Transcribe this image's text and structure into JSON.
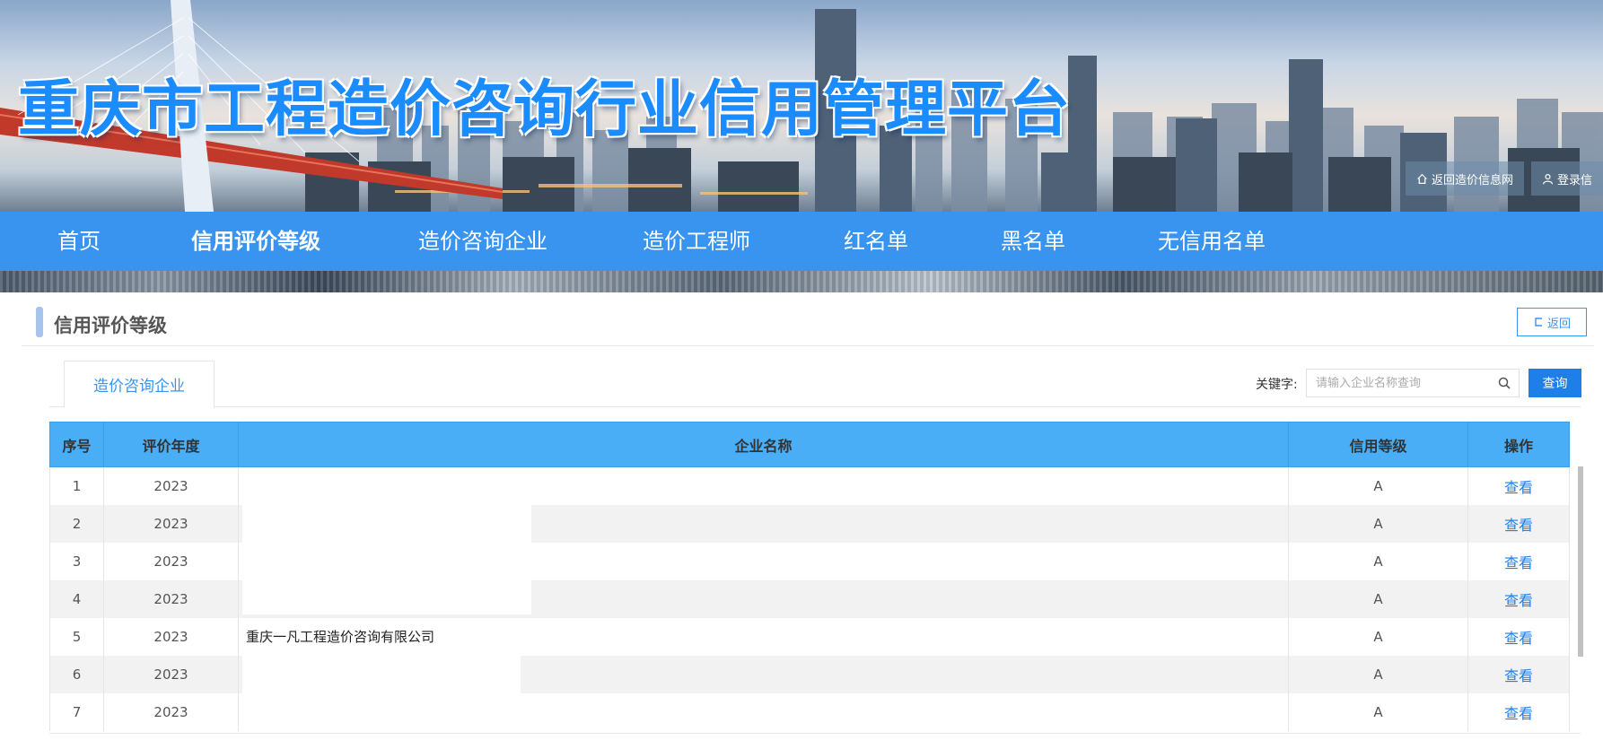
{
  "banner": {
    "title": "重庆市工程造价咨询行业信用管理平台",
    "links": [
      {
        "label": "返回造价信息网",
        "icon": "home-icon"
      },
      {
        "label": "登录信",
        "icon": "user-icon"
      }
    ]
  },
  "nav": {
    "items": [
      "首页",
      "信用评价等级",
      "造价咨询企业",
      "造价工程师",
      "红名单",
      "黑名单",
      "无信用名单"
    ],
    "active_index": 1
  },
  "section": {
    "title": "信用评价等级",
    "back_label": "返回"
  },
  "tabs": {
    "active": "造价咨询企业"
  },
  "search": {
    "label": "关键字:",
    "placeholder": "请输入企业名称查询",
    "button": "查询"
  },
  "table": {
    "headers": [
      "序号",
      "评价年度",
      "企业名称",
      "信用等级",
      "操作"
    ],
    "rows": [
      {
        "no": "1",
        "year": "2023",
        "name": "",
        "grade": "A",
        "action": "查看"
      },
      {
        "no": "2",
        "year": "2023",
        "name": "",
        "grade": "A",
        "action": "查看"
      },
      {
        "no": "3",
        "year": "2023",
        "name": "",
        "grade": "A",
        "action": "查看"
      },
      {
        "no": "4",
        "year": "2023",
        "name": "",
        "grade": "A",
        "action": "查看"
      },
      {
        "no": "5",
        "year": "2023",
        "name": "重庆一凡工程造价咨询有限公司",
        "grade": "A",
        "action": "查看"
      },
      {
        "no": "6",
        "year": "2023",
        "name": "",
        "grade": "A",
        "action": "查看"
      },
      {
        "no": "7",
        "year": "2023",
        "name": "",
        "grade": "A",
        "action": "查看"
      }
    ]
  },
  "colors": {
    "nav_bg": "#3894ef",
    "table_header_bg": "#4aaef7",
    "accent": "#1f7fe8"
  }
}
